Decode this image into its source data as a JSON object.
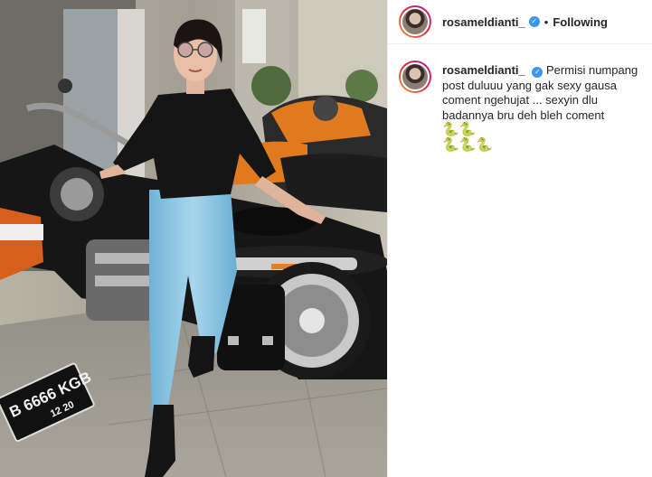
{
  "post": {
    "username": "rosameldianti_",
    "verified_icon": "verified-badge-icon",
    "separator": "•",
    "follow_label": "Following",
    "caption": {
      "username": "rosameldianti_",
      "text": "Permisi numpang post duluuu yang gak sexy gausa coment ngehujat ... sexyin dlu badannya bru deh bleh coment",
      "emojis_line1": "🐍🐍",
      "emojis_line2": "🐍🐍🐍"
    },
    "photo": {
      "plate_line1": "B 6666 KGB",
      "plate_line2": "12 20"
    }
  },
  "colors": {
    "verified_blue": "#3897f0",
    "text": "#262626",
    "divider": "#efefef"
  }
}
